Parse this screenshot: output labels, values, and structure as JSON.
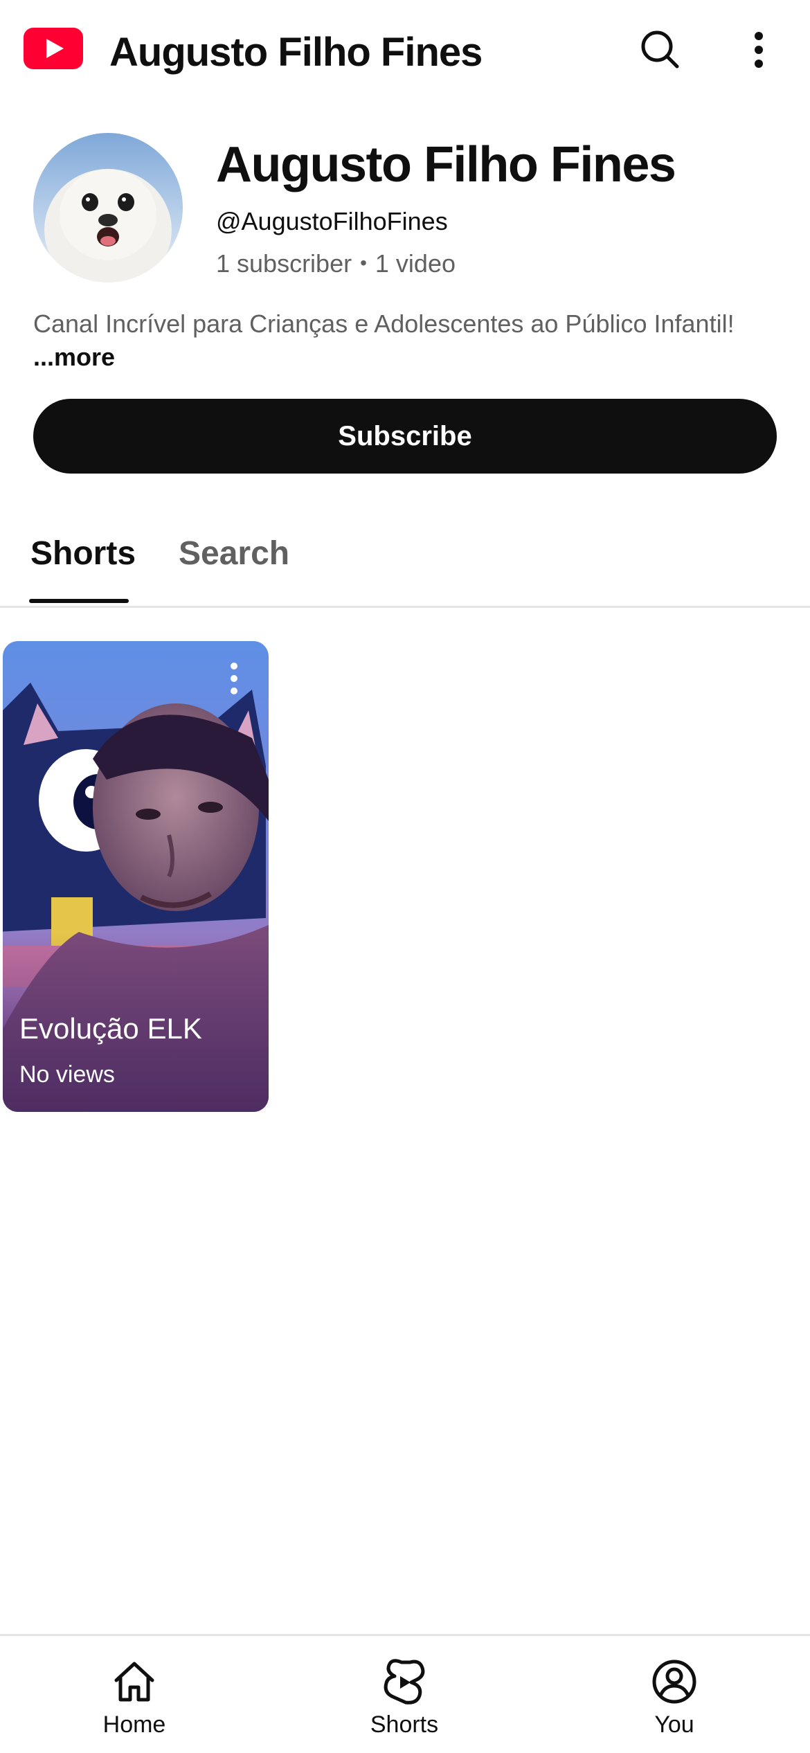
{
  "topbar": {
    "title": "Augusto Filho Fines",
    "logo_icon": "youtube-logo-icon",
    "search_icon": "search-icon",
    "more_icon": "more-vertical-icon",
    "brand_color": "#ff0033"
  },
  "channel": {
    "name": "Augusto Filho Fines",
    "handle": "@AugustoFilhoFines",
    "subscribers": "1 subscriber",
    "separator": "•",
    "videos": "1 video",
    "description": "Canal Incrível para Crianças e Adolescentes ao Público Infantil!",
    "more_label": "...more",
    "subscribe_label": "Subscribe"
  },
  "tabs": [
    {
      "label": "Shorts",
      "selected": true
    },
    {
      "label": "Search",
      "selected": false
    }
  ],
  "shorts": [
    {
      "title": "Evolução ELK",
      "views": "No views"
    }
  ],
  "bottom_nav": {
    "items": [
      {
        "label": "Home",
        "icon": "home-icon"
      },
      {
        "label": "Shorts",
        "icon": "shorts-icon"
      },
      {
        "label": "You",
        "icon": "account-circle-icon"
      }
    ]
  }
}
